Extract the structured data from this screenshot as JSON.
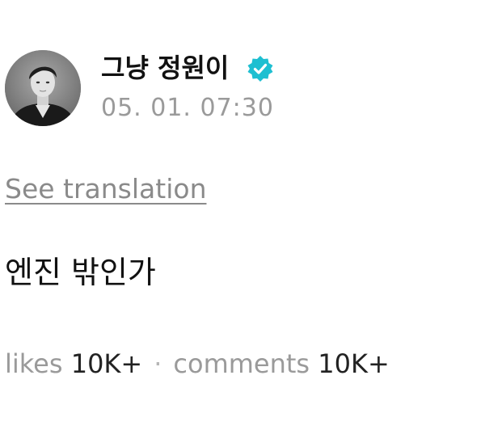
{
  "post": {
    "author": {
      "name": "그냥 정원이",
      "verified": true,
      "verified_color": "#1ebfd1"
    },
    "timestamp": "05. 01. 07:30",
    "translate_label": "See translation",
    "body": "엔진 밖인가",
    "stats": {
      "likes_label": "likes",
      "likes_value": "10K+",
      "separator": "·",
      "comments_label": "comments",
      "comments_value": "10K+"
    }
  },
  "icons": {
    "verified": "verified-badge-icon",
    "avatar": "profile-photo"
  }
}
